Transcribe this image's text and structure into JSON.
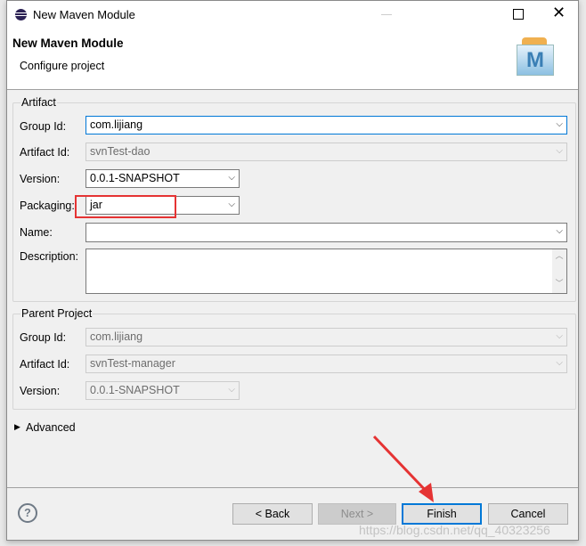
{
  "window": {
    "title": "New Maven Module"
  },
  "header": {
    "title": "New Maven Module",
    "subtitle": "Configure project",
    "logo_letter": "M"
  },
  "artifact": {
    "legend": "Artifact",
    "group_id": {
      "label": "Group Id:",
      "value": "com.lijiang"
    },
    "artifact_id": {
      "label": "Artifact Id:",
      "value": "svnTest-dao"
    },
    "version": {
      "label": "Version:",
      "value": "0.0.1-SNAPSHOT"
    },
    "packaging": {
      "label": "Packaging:",
      "value": "jar"
    },
    "name": {
      "label": "Name:",
      "value": ""
    },
    "description": {
      "label": "Description:",
      "value": ""
    }
  },
  "parent": {
    "legend": "Parent Project",
    "group_id": {
      "label": "Group Id:",
      "value": "com.lijiang"
    },
    "artifact_id": {
      "label": "Artifact Id:",
      "value": "svnTest-manager"
    },
    "version": {
      "label": "Version:",
      "value": "0.0.1-SNAPSHOT"
    }
  },
  "advanced": {
    "label": "Advanced"
  },
  "buttons": {
    "back": "< Back",
    "next": "Next >",
    "finish": "Finish",
    "cancel": "Cancel"
  },
  "watermark": "https://blog.csdn.net/qq_40323256",
  "colors": {
    "highlight": "#e53333",
    "focus": "#0078d7"
  }
}
